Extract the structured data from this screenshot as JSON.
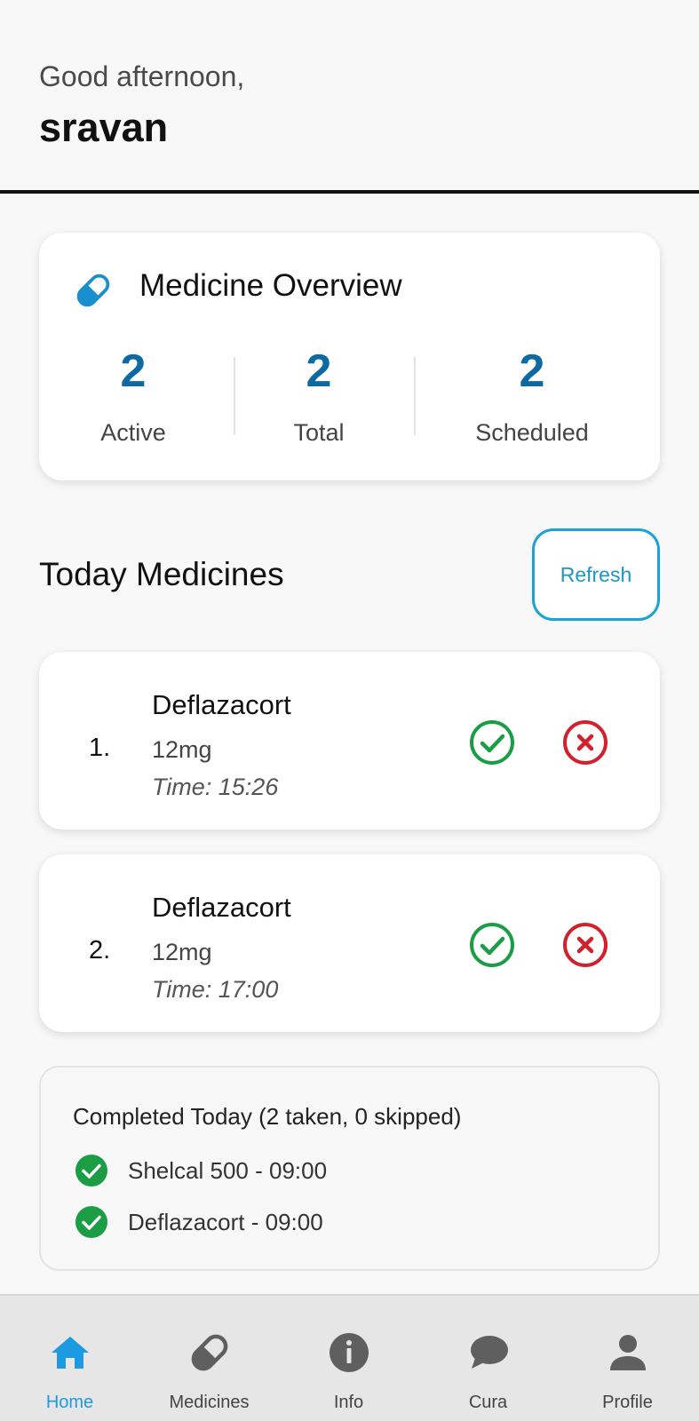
{
  "header": {
    "greeting": "Good afternoon,",
    "username": "sravan"
  },
  "overview": {
    "title": "Medicine Overview",
    "icon": "pill-icon",
    "stats": [
      {
        "value": "2",
        "label": "Active"
      },
      {
        "value": "2",
        "label": "Total"
      },
      {
        "value": "2",
        "label": "Scheduled"
      }
    ]
  },
  "today": {
    "title": "Today Medicines",
    "refresh_label": "Refresh",
    "items": [
      {
        "index": "1.",
        "name": "Deflazacort",
        "dose": "12mg",
        "time": "Time: 15:26"
      },
      {
        "index": "2.",
        "name": "Deflazacort",
        "dose": "12mg",
        "time": "Time: 17:00"
      }
    ]
  },
  "completed": {
    "title": "Completed Today (2 taken, 0 skipped)",
    "items": [
      {
        "text": "Shelcal 500 - 09:00"
      },
      {
        "text": "Deflazacort - 09:00"
      }
    ]
  },
  "nav": {
    "items": [
      {
        "label": "Home",
        "icon": "home-icon",
        "active": true
      },
      {
        "label": "Medicines",
        "icon": "pill-icon",
        "active": false
      },
      {
        "label": "Info",
        "icon": "info-icon",
        "active": false
      },
      {
        "label": "Cura",
        "icon": "chat-bubble-icon",
        "active": false
      },
      {
        "label": "Profile",
        "icon": "person-icon",
        "active": false
      }
    ]
  },
  "colors": {
    "accent": "#1d9be0",
    "stat_number": "#0b6aa3",
    "success": "#1a9d45",
    "danger": "#d0212c"
  }
}
